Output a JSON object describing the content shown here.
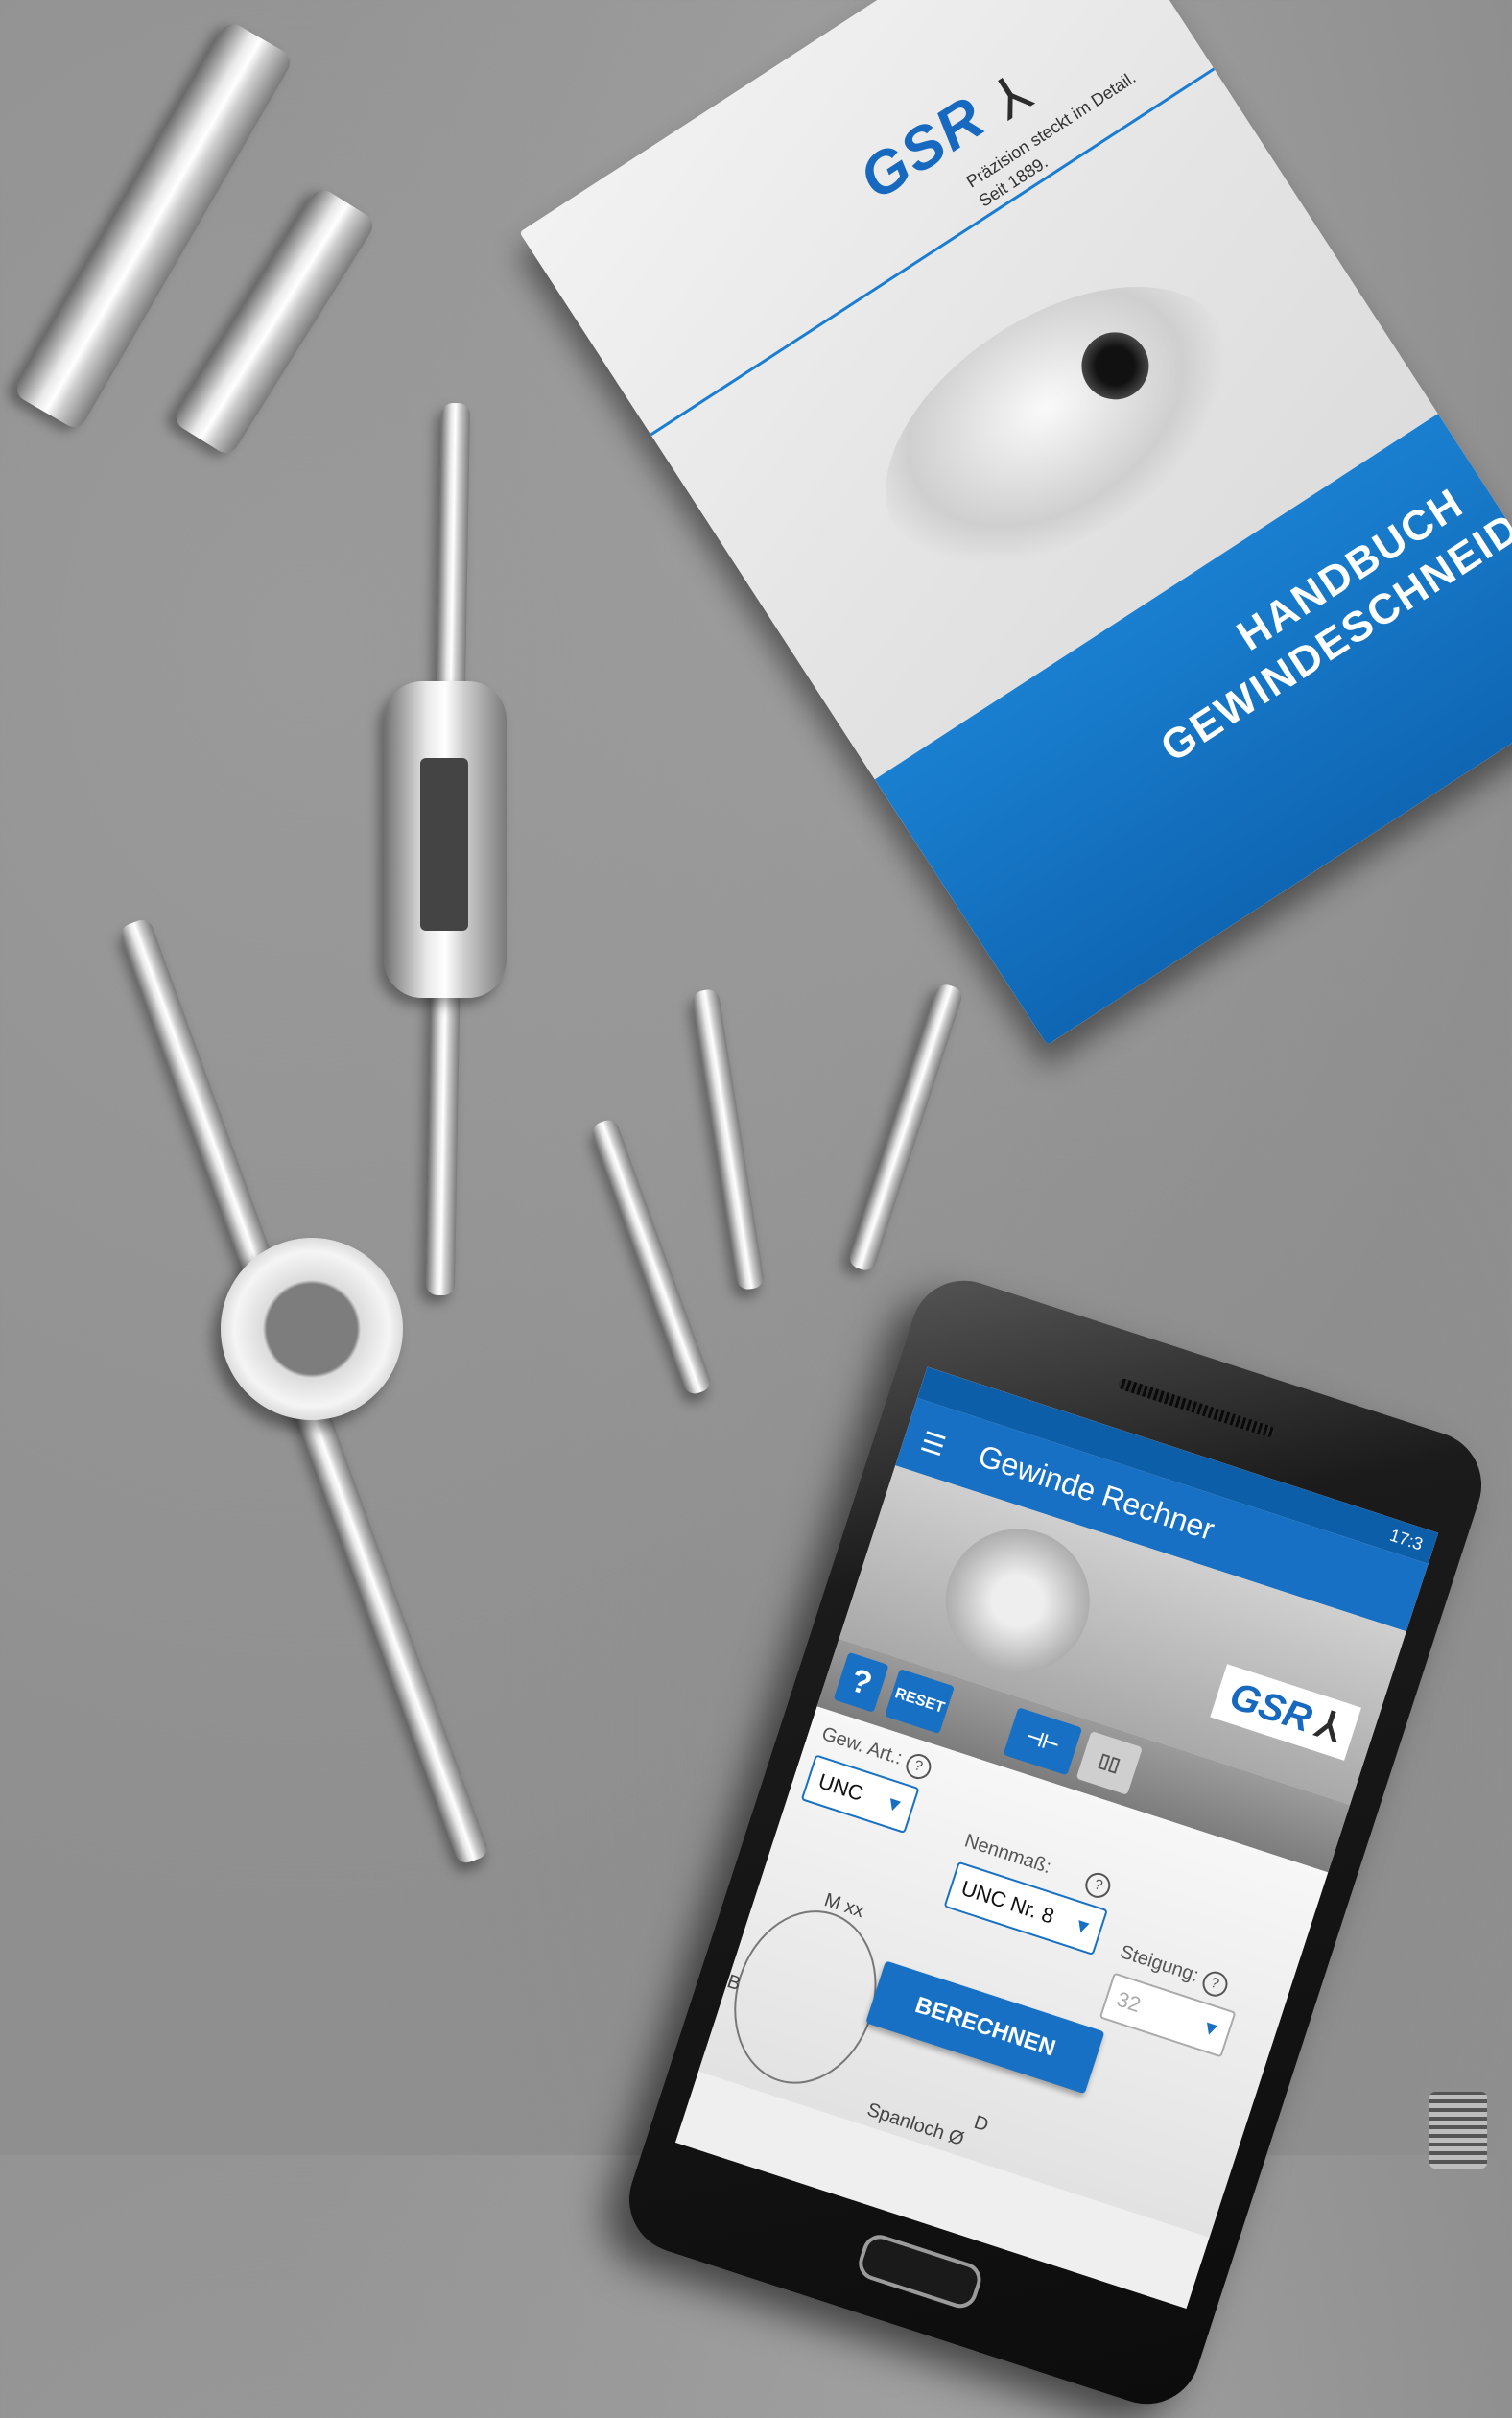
{
  "book": {
    "brand": "GSR",
    "brand_mark": "⅄",
    "tagline_1": "Präzision steckt im Detail.",
    "tagline_2": "Seit 1889.",
    "title_1": "HANDBUCH",
    "title_2": "GEWINDESCHNEIDEN"
  },
  "phone": {
    "status_time": "17:3",
    "app_title": "Gewinde Rechner",
    "menu_icon": "hamburger-menu-icon",
    "hero_brand": "GSR",
    "hero_mark": "⅄",
    "toolbar": {
      "help_label": "?",
      "reset_label": "RESET"
    },
    "form": {
      "thread_type_label": "Gew. Art.:",
      "thread_type_value": "UNC",
      "nominal_label": "Nennmaß:",
      "nominal_value": "UNC Nr. 8",
      "pitch_label": "Steigung:",
      "pitch_value": "32",
      "calculate_label": "BERECHNEN",
      "help_glyph": "?"
    },
    "drawing_labels": {
      "a": "M xx",
      "b": "B",
      "d": "D",
      "chip": "Spanloch Ø"
    }
  },
  "colors": {
    "brand_blue": "#1770c4",
    "concrete": "#8f8f8f"
  }
}
